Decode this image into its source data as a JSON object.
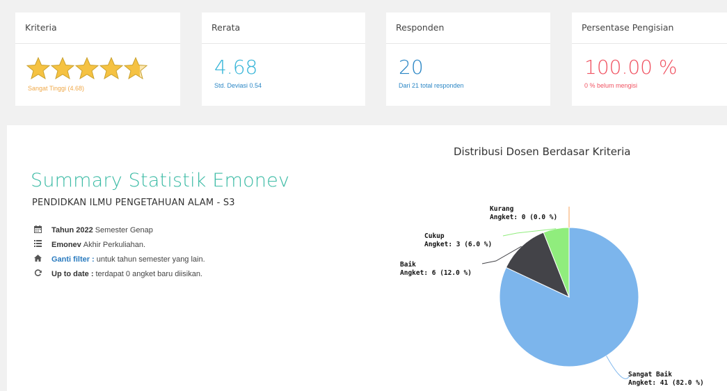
{
  "cards": {
    "kriteria": {
      "title": "Kriteria",
      "stars_rating": 4.68,
      "stars_max": 5,
      "subtitle": "Sangat Tinggi (4.68)",
      "star_color": "#f5c242",
      "subtitle_color": "#f0a94a"
    },
    "rerata": {
      "title": "Rerata",
      "value": "4.68",
      "subtitle": "Std. Deviasi 0.54",
      "color": "#36b5d8"
    },
    "responden": {
      "title": "Responden",
      "value": "20",
      "subtitle": "Dari 21 total responden",
      "color": "#2a86c5"
    },
    "persentase": {
      "title": "Persentase Pengisian",
      "value": "100.00 %",
      "subtitle": "0 % belum mengisi",
      "color": "#f05261"
    }
  },
  "summary": {
    "title": "Summary Statistik Emonev",
    "subtitle": "PENDIDKAN ILMU PENGETAHUAN ALAM - S3",
    "items": [
      {
        "icon": "calendar-icon",
        "bold": "Tahun 2022",
        "text": " Semester Genap"
      },
      {
        "icon": "list-icon",
        "bold": "Emonev",
        "text": " Akhir Perkuliahan."
      },
      {
        "icon": "home-icon",
        "bold": "Ganti filter :",
        "text": " untuk tahun semester yang lain."
      },
      {
        "icon": "refresh-icon",
        "bold": "Up to date :",
        "text": " terdapat 0 angket baru diisikan."
      }
    ]
  },
  "chart_data": {
    "type": "pie",
    "title": "Distribusi Dosen Berdasar Kriteria",
    "slices": [
      {
        "name": "Sangat Baik",
        "value": 41,
        "percent": 82.0,
        "color": "#7cb5ec",
        "label": "Angket: 41 (82.0 %)"
      },
      {
        "name": "Baik",
        "value": 6,
        "percent": 12.0,
        "color": "#434348",
        "label": "Angket: 6 (12.0 %)"
      },
      {
        "name": "Cukup",
        "value": 3,
        "percent": 6.0,
        "color": "#90ed7d",
        "label": "Angket: 3 (6.0 %)"
      },
      {
        "name": "Kurang",
        "value": 0,
        "percent": 0.0,
        "color": "#f7a35c",
        "label": "Angket: 0 (0.0 %)"
      }
    ]
  }
}
